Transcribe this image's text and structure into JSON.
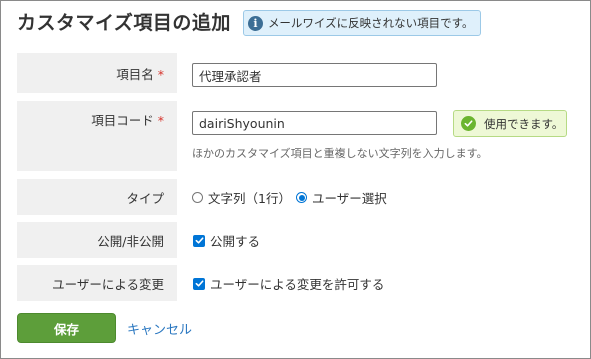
{
  "header": {
    "title": "カスタマイズ項目の追加",
    "info_message": "メールワイズに反映されない項目です。"
  },
  "form": {
    "name": {
      "label": "項目名",
      "required_mark": "*",
      "value": "代理承認者"
    },
    "code": {
      "label": "項目コード",
      "required_mark": "*",
      "value": "dairiShyounin",
      "status": "使用できます。",
      "help": "ほかのカスタマイズ項目と重複しない文字列を入力します。"
    },
    "type": {
      "label": "タイプ",
      "options": [
        "文字列（1行）",
        "ユーザー選択"
      ],
      "selected": "ユーザー選択"
    },
    "visibility": {
      "label": "公開/非公開",
      "checkbox_label": "公開する",
      "checked": true
    },
    "user_change": {
      "label": "ユーザーによる変更",
      "checkbox_label": "ユーザーによる変更を許可する",
      "checked": true
    }
  },
  "actions": {
    "save_label": "保存",
    "cancel_label": "キャンセル"
  },
  "colors": {
    "save_button": "#5d9e3a",
    "cancel_link": "#2a77c0",
    "required_mark": "#d6332c",
    "info_badge_bg": "#dff0fb",
    "ok_badge_bg": "#eef8d6",
    "label_bg": "#f0f0f0"
  }
}
